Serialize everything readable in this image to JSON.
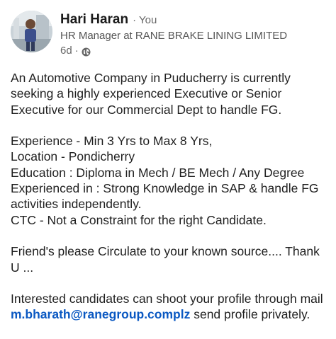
{
  "post": {
    "author": {
      "name": "Hari Haran",
      "relation": "You",
      "headline": "HR Manager at RANE BRAKE LINING LIMITED",
      "time": "6d",
      "visibility_icon": "globe-icon"
    },
    "body_lines": [
      "An Automotive Company in Puducherry is currently",
      "seeking a highly experienced Executive or Senior",
      "Executive for our Commercial Dept to handle FG.",
      "Experience - Min 3 Yrs to Max 8 Yrs,",
      "Location - Pondicherry",
      "Education : Diploma in Mech / BE Mech / Any Degree",
      "Experienced in : Strong Knowledge in SAP & handle FG",
      "activities independently.",
      "CTC - Not a Constraint for the right Candidate.",
      "Friend's please Circulate to your known source.... Thank",
      "U ...",
      "Interested candidates can shoot your profile through mail"
    ],
    "email": "m.bharath@ranegroup.complz",
    "after_email": " send profile privately."
  },
  "colors": {
    "link": "#0a58c2",
    "text": "#1f1f1f",
    "muted": "#666666"
  }
}
